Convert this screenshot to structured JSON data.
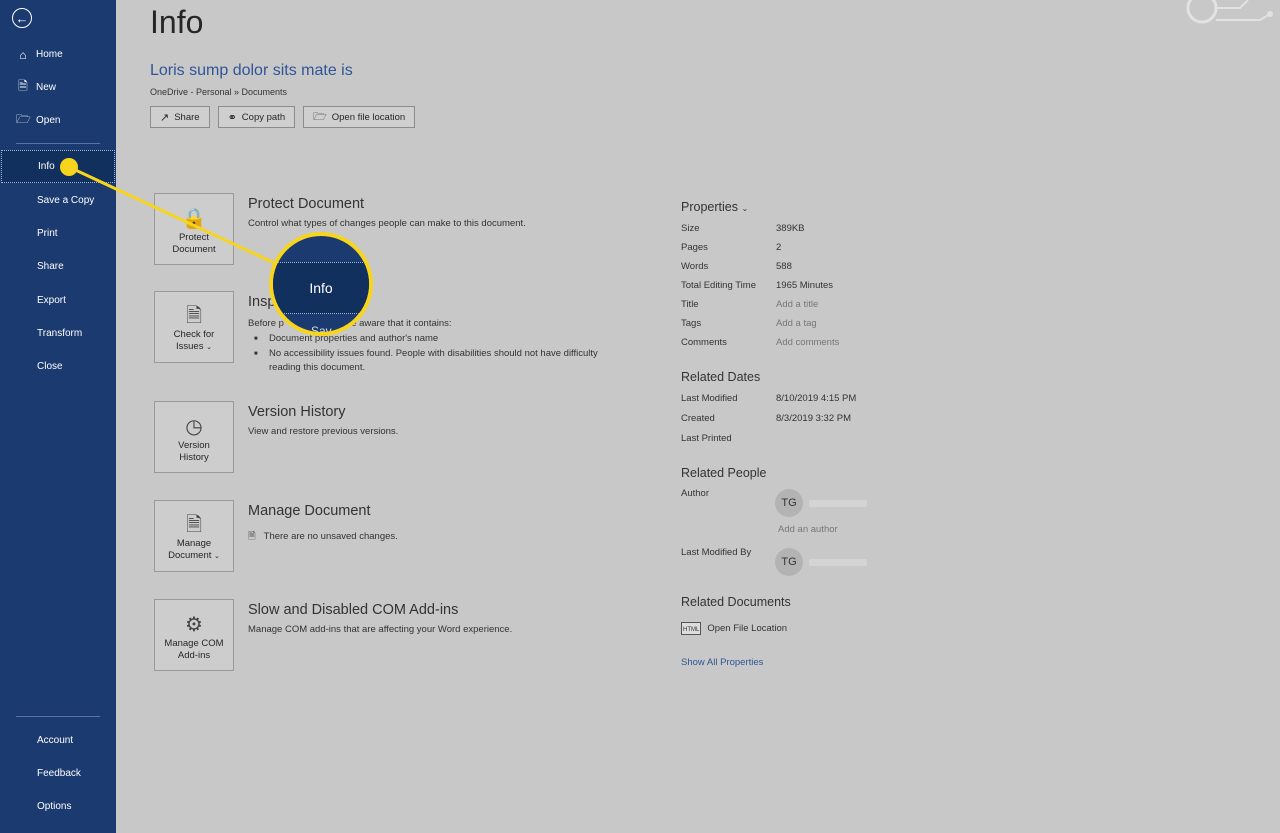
{
  "sidebar": {
    "back_icon": "arrow-left-circle-icon",
    "top_items": [
      {
        "label": "Home",
        "icon": "home-icon"
      },
      {
        "label": "New",
        "icon": "new-document-icon"
      },
      {
        "label": "Open",
        "icon": "folder-open-icon"
      }
    ],
    "menu_items": [
      {
        "label": "Info",
        "active": true
      },
      {
        "label": "Save a Copy"
      },
      {
        "label": "Print"
      },
      {
        "label": "Share"
      },
      {
        "label": "Export"
      },
      {
        "label": "Transform"
      },
      {
        "label": "Close"
      }
    ],
    "bottom_items": [
      {
        "label": "Account"
      },
      {
        "label": "Feedback"
      },
      {
        "label": "Options"
      }
    ]
  },
  "main": {
    "page_title": "Info",
    "doc_title": "Loris sump dolor sits mate is",
    "breadcrumb": "OneDrive - Personal » Documents",
    "buttons": {
      "share": "Share",
      "copy_path": "Copy path",
      "open_location": "Open file location"
    }
  },
  "sections": {
    "protect": {
      "button": "Protect Document",
      "heading": "Protect Document",
      "desc": "Control what types of changes people can make to this document."
    },
    "inspect": {
      "button_line1": "Check for",
      "button_line2": "Issues",
      "heading": "Insp",
      "desc_start": "Before p",
      "desc_end": "be aware that it contains:",
      "bullets": [
        "Document properties and author's name",
        "No accessibility issues found. People with disabilities should not have difficulty reading this document."
      ]
    },
    "version": {
      "button_line1": "Version",
      "button_line2": "History",
      "heading": "Version History",
      "desc": "View and restore previous versions."
    },
    "manage": {
      "button_line1": "Manage",
      "button_line2": "Document",
      "heading": "Manage Document",
      "desc": "There are no unsaved changes."
    },
    "addins": {
      "button_line1": "Manage COM",
      "button_line2": "Add-ins",
      "heading": "Slow and Disabled COM Add-ins",
      "desc": "Manage COM add-ins that are affecting your Word experience."
    }
  },
  "properties": {
    "heading": "Properties",
    "rows": [
      {
        "label": "Size",
        "value": "389KB"
      },
      {
        "label": "Pages",
        "value": "2"
      },
      {
        "label": "Words",
        "value": "588"
      },
      {
        "label": "Total Editing Time",
        "value": "1965 Minutes"
      },
      {
        "label": "Title",
        "value": "Add a title"
      },
      {
        "label": "Tags",
        "value": "Add a tag"
      },
      {
        "label": "Comments",
        "value": "Add comments"
      }
    ],
    "dates_heading": "Related Dates",
    "dates": [
      {
        "label": "Last Modified",
        "value": "8/10/2019 4:15 PM"
      },
      {
        "label": "Created",
        "value": "8/3/2019 3:32 PM"
      },
      {
        "label": "Last Printed",
        "value": ""
      }
    ],
    "people_heading": "Related People",
    "author_label": "Author",
    "author_initials": "TG",
    "add_author": "Add an author",
    "last_modified_by_label": "Last Modified By",
    "last_modified_by_initials": "TG",
    "documents_heading": "Related Documents",
    "open_file_location": "Open File Location",
    "show_all": "Show All Properties"
  },
  "callout": {
    "label": "Info",
    "next_label": "Sav"
  },
  "colors": {
    "sidebar": "#1b3a70",
    "highlight": "#f7d51d",
    "link": "#2f5597"
  }
}
